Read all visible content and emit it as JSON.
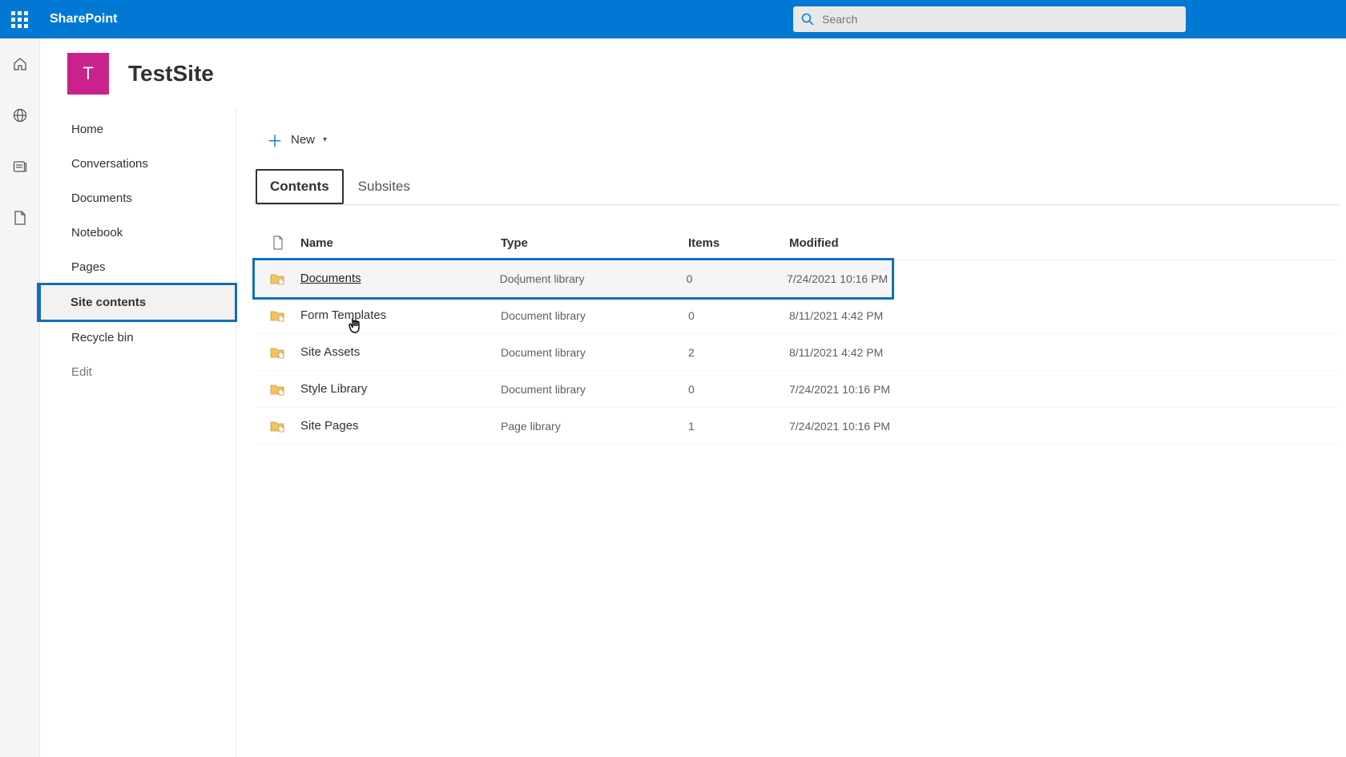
{
  "header": {
    "brand": "SharePoint",
    "search_placeholder": "Search"
  },
  "site": {
    "logo_letter": "T",
    "title": "TestSite"
  },
  "nav": {
    "items": [
      {
        "label": "Home",
        "selected": false
      },
      {
        "label": "Conversations",
        "selected": false
      },
      {
        "label": "Documents",
        "selected": false
      },
      {
        "label": "Notebook",
        "selected": false
      },
      {
        "label": "Pages",
        "selected": false
      },
      {
        "label": "Site contents",
        "selected": true
      },
      {
        "label": "Recycle bin",
        "selected": false
      }
    ],
    "edit": "Edit"
  },
  "commands": {
    "new": "New"
  },
  "tabs": {
    "contents": "Contents",
    "subsites": "Subsites",
    "active": "contents"
  },
  "columns": {
    "name": "Name",
    "type": "Type",
    "items": "Items",
    "modified": "Modified"
  },
  "rows": [
    {
      "name": "Documents",
      "type": "Document library",
      "items": "0",
      "modified": "7/24/2021 10:16 PM",
      "hovered": true,
      "highlighted": true
    },
    {
      "name": "Form Templates",
      "type": "Document library",
      "items": "0",
      "modified": "8/11/2021 4:42 PM",
      "hovered": false,
      "highlighted": false
    },
    {
      "name": "Site Assets",
      "type": "Document library",
      "items": "2",
      "modified": "8/11/2021 4:42 PM",
      "hovered": false,
      "highlighted": false
    },
    {
      "name": "Style Library",
      "type": "Document library",
      "items": "0",
      "modified": "7/24/2021 10:16 PM",
      "hovered": false,
      "highlighted": false
    },
    {
      "name": "Site Pages",
      "type": "Page library",
      "items": "1",
      "modified": "7/24/2021 10:16 PM",
      "hovered": false,
      "highlighted": false
    }
  ]
}
